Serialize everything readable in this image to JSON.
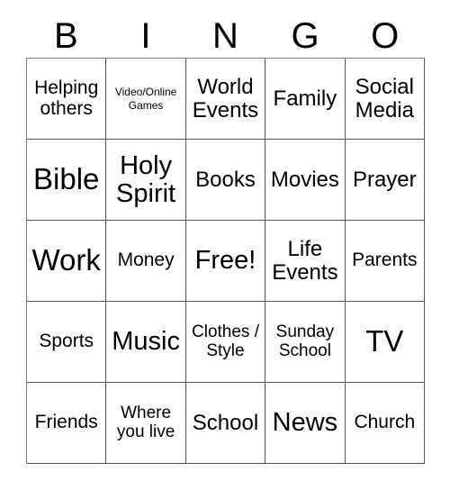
{
  "card": {
    "header_letters": [
      "B",
      "I",
      "N",
      "G",
      "O"
    ],
    "rows": [
      [
        {
          "label": "Helping others",
          "size": "md"
        },
        {
          "label": "Video/Online Games",
          "size": "xs"
        },
        {
          "label": "World Events",
          "size": "lg"
        },
        {
          "label": "Family",
          "size": "lg"
        },
        {
          "label": "Social Media",
          "size": "lg"
        }
      ],
      [
        {
          "label": "Bible",
          "size": "xxl"
        },
        {
          "label": "Holy Spirit",
          "size": "xl"
        },
        {
          "label": "Books",
          "size": "lg"
        },
        {
          "label": "Movies",
          "size": "lg"
        },
        {
          "label": "Prayer",
          "size": "lg"
        }
      ],
      [
        {
          "label": "Work",
          "size": "xxl"
        },
        {
          "label": "Money",
          "size": "md"
        },
        {
          "label": "Free!",
          "size": "xl"
        },
        {
          "label": "Life Events",
          "size": "lg"
        },
        {
          "label": "Parents",
          "size": "md"
        }
      ],
      [
        {
          "label": "Sports",
          "size": "md"
        },
        {
          "label": "Music",
          "size": "xl"
        },
        {
          "label": "Clothes / Style",
          "size": "sm"
        },
        {
          "label": "Sunday School",
          "size": "sm"
        },
        {
          "label": "TV",
          "size": "xxl"
        }
      ],
      [
        {
          "label": "Friends",
          "size": "md"
        },
        {
          "label": "Where you live",
          "size": "sm"
        },
        {
          "label": "School",
          "size": "lg"
        },
        {
          "label": "News",
          "size": "xl"
        },
        {
          "label": "Church",
          "size": "md"
        }
      ]
    ],
    "free_space_label": "Free!",
    "colors": {
      "background": "#ffffff",
      "text": "#000000",
      "grid_line": "#555555"
    }
  }
}
